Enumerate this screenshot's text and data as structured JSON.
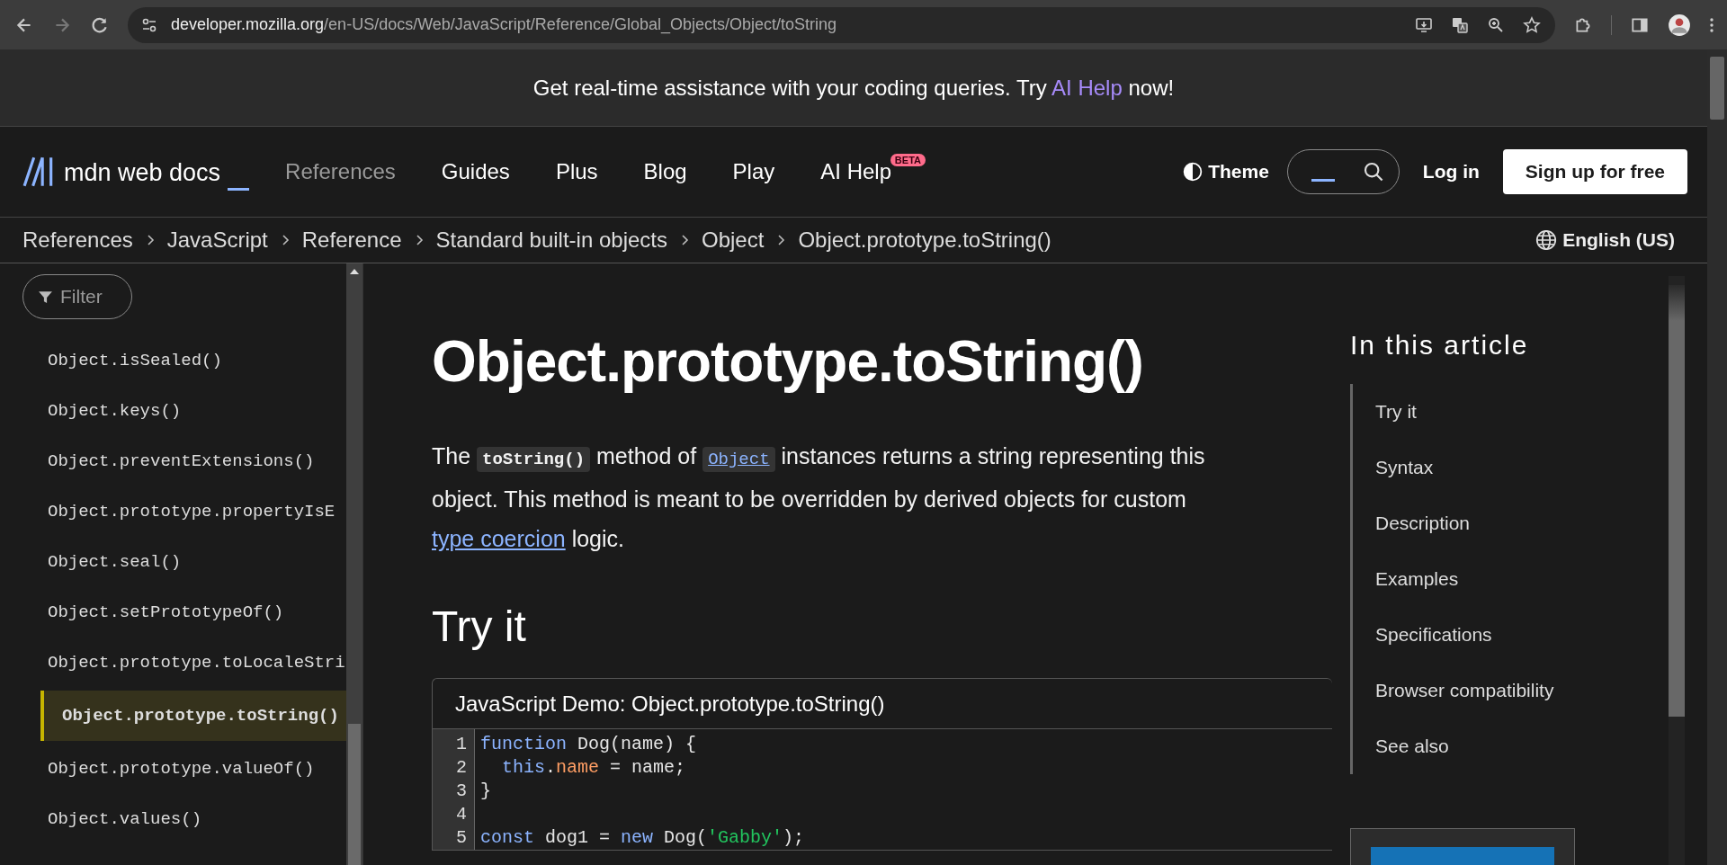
{
  "browser": {
    "url_host": "developer.mozilla.org",
    "url_path": "/en-US/docs/Web/JavaScript/Reference/Global_Objects/Object/toString"
  },
  "banner": {
    "segments": [
      {
        "kind": "text",
        "text": "Get real-time assistance with your coding queries. Try "
      },
      {
        "kind": "link",
        "text": "AI Help"
      },
      {
        "kind": "text",
        "text": " now!"
      }
    ]
  },
  "header": {
    "logo": "mdn web docs",
    "nav": [
      {
        "label": "References",
        "selected": true
      },
      {
        "label": "Guides",
        "selected": false
      },
      {
        "label": "Plus",
        "selected": false
      },
      {
        "label": "Blog",
        "selected": false
      },
      {
        "label": "Play",
        "selected": false
      },
      {
        "label": "AI Help",
        "selected": false,
        "badge": "BETA"
      }
    ],
    "theme": "Theme",
    "login": "Log in",
    "signup": "Sign up for free"
  },
  "breadcrumbs": [
    "References",
    "JavaScript",
    "Reference",
    "Standard built-in objects",
    "Object",
    "Object.prototype.toString()"
  ],
  "language": "English (US)",
  "sidebar": {
    "filter": "Filter",
    "items": [
      {
        "label": "Object.isSealed()",
        "selected": false
      },
      {
        "label": "Object.keys()",
        "selected": false
      },
      {
        "label": "Object.preventExtensions()",
        "selected": false
      },
      {
        "label": "Object.prototype.propertyIsE",
        "selected": false
      },
      {
        "label": "Object.seal()",
        "selected": false
      },
      {
        "label": "Object.setPrototypeOf()",
        "selected": false
      },
      {
        "label": "Object.prototype.toLocaleStri",
        "selected": false
      },
      {
        "label": "Object.prototype.toString()",
        "selected": true
      },
      {
        "label": "Object.prototype.valueOf()",
        "selected": false
      },
      {
        "label": "Object.values()",
        "selected": false
      }
    ]
  },
  "article": {
    "title": "Object.prototype.toString()",
    "paragraph": [
      {
        "kind": "text",
        "text": "The "
      },
      {
        "kind": "code",
        "text": "toString()"
      },
      {
        "kind": "text",
        "text": " method of "
      },
      {
        "kind": "code-link",
        "text": "Object"
      },
      {
        "kind": "text",
        "text": " instances returns a string representing this object. This method is meant to be overridden by derived objects for custom "
      },
      {
        "kind": "link",
        "text": "type coercion"
      },
      {
        "kind": "text",
        "text": " logic."
      }
    ],
    "section_title": "Try it",
    "demo": {
      "title": "JavaScript Demo: Object.prototype.toString()",
      "lines": [
        {
          "number": "1",
          "tokens": [
            {
              "kind": "keyword",
              "text": "function"
            },
            {
              "kind": "plain",
              "text": " Dog(name) {"
            }
          ]
        },
        {
          "number": "2",
          "tokens": [
            {
              "kind": "keyword",
              "text": "  this"
            },
            {
              "kind": "plain",
              "text": "."
            },
            {
              "kind": "property",
              "text": "name"
            },
            {
              "kind": "plain",
              "text": " = name;"
            }
          ]
        },
        {
          "number": "3",
          "tokens": [
            {
              "kind": "plain",
              "text": "}"
            }
          ]
        },
        {
          "number": "4"
        },
        {
          "number": "5",
          "tokens": [
            {
              "kind": "keyword",
              "text": "const"
            },
            {
              "kind": "plain",
              "text": " dog1 = "
            },
            {
              "kind": "keyword",
              "text": "new"
            },
            {
              "kind": "plain",
              "text": " Dog("
            },
            {
              "kind": "string",
              "text": "'Gabby'"
            },
            {
              "kind": "plain",
              "text": ");"
            }
          ]
        }
      ]
    }
  },
  "toc": {
    "title": "In this article",
    "items": [
      "Try it",
      "Syntax",
      "Description",
      "Examples",
      "Specifications",
      "Browser compatibility",
      "See also"
    ]
  }
}
